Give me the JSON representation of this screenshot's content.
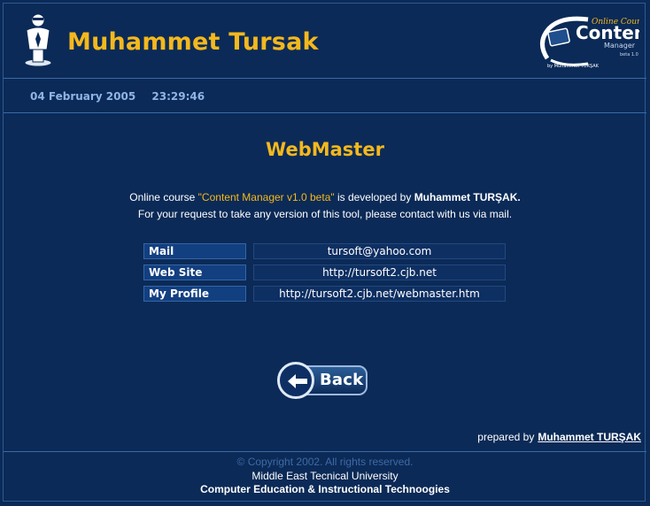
{
  "header": {
    "site_title": "Muhammet Tursak",
    "brand": {
      "line1": "Online Course",
      "line2": "Content",
      "line3": "Manager",
      "version": "beta 1.0",
      "byline": "by Muhammet TURŞAK"
    }
  },
  "datetime": {
    "date": "04 February 2005",
    "time": "23:29:46"
  },
  "page": {
    "heading": "WebMaster",
    "desc": {
      "part1": "Online course ",
      "product": "\"Content Manager v1.0 beta\"",
      "part2": " is developed by ",
      "author": "Muhammet TURŞAK.",
      "line2": "For your request to take any version of this tool, please contact with us via mail."
    }
  },
  "contact": [
    {
      "label": "Mail",
      "value": "tursoft@yahoo.com"
    },
    {
      "label": "Web Site",
      "value": "http://tursoft2.cjb.net"
    },
    {
      "label": "My Profile",
      "value": "http://tursoft2.cjb.net/webmaster.htm"
    }
  ],
  "back_button": {
    "label": "Back"
  },
  "prepared_by": {
    "prefix": "prepared by",
    "author": "Muhammet TURŞAK"
  },
  "footer": {
    "copyright": "© Copyright 2002. All rights reserved.",
    "university": "Middle East Tecnical University",
    "department": "Computer Education & Instructional Technoogies"
  },
  "colors": {
    "background": "#0b2a57",
    "accent": "#f4b81d",
    "date_text": "#8fb4e6",
    "label_bg": "#123f80"
  }
}
